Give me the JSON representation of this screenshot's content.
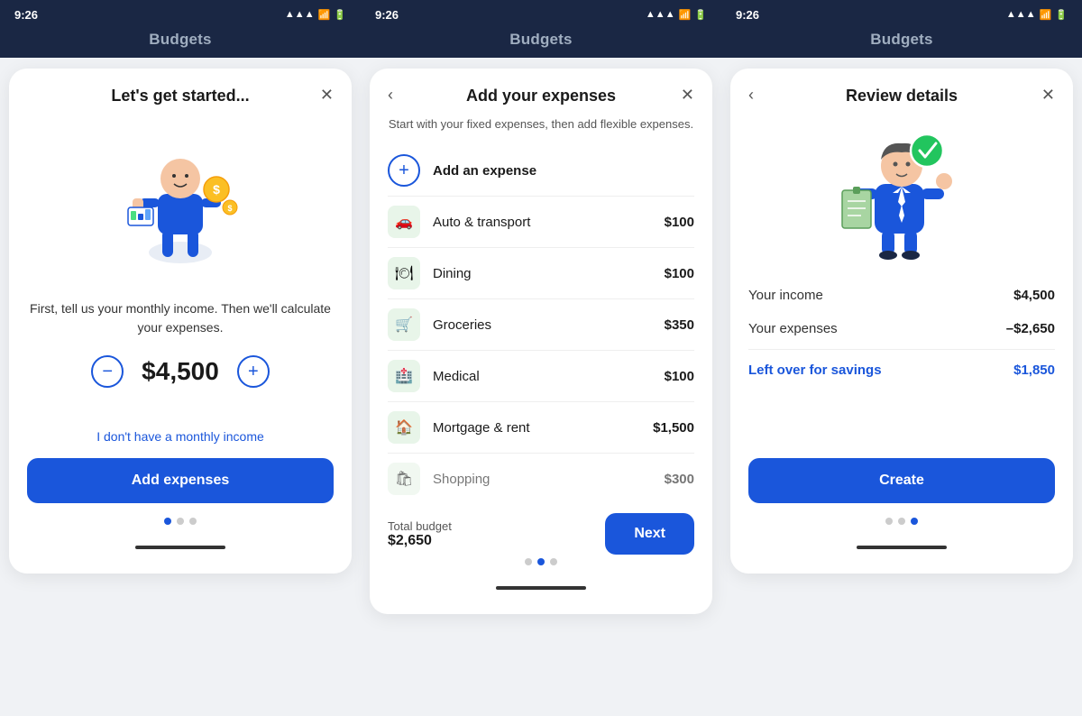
{
  "app_title": "Budgets",
  "status_bar": {
    "time": "9:26",
    "signal": "▲▲▲",
    "wifi": "WiFi",
    "battery": "Batt"
  },
  "panel1": {
    "title": "Let's get started...",
    "description": "First, tell us your monthly income.\nThen we'll calculate your expenses.",
    "income": "$4,500",
    "no_income_link": "I don't have a monthly income",
    "cta": "Add expenses",
    "dots": [
      true,
      false,
      false
    ]
  },
  "panel2": {
    "title": "Add your expenses",
    "subtitle": "Start with your fixed expenses,\nthen add flexible expenses.",
    "add_label": "Add an expense",
    "expenses": [
      {
        "name": "Auto & transport",
        "amount": "$100",
        "icon": "🚗"
      },
      {
        "name": "Dining",
        "amount": "$100",
        "icon": "🍽"
      },
      {
        "name": "Groceries",
        "amount": "$350",
        "icon": "🛒"
      },
      {
        "name": "Medical",
        "amount": "$100",
        "icon": "🏥"
      },
      {
        "name": "Mortgage & rent",
        "amount": "$1,500",
        "icon": "🏠"
      },
      {
        "name": "Shopping",
        "amount": "$300",
        "icon": "🛍"
      }
    ],
    "total_label": "Total budget",
    "total_value": "$2,650",
    "next_btn": "Next",
    "dots": [
      false,
      true,
      false
    ]
  },
  "panel3": {
    "title": "Review details",
    "income_label": "Your income",
    "income_value": "$4,500",
    "expenses_label": "Your expenses",
    "expenses_value": "–$2,650",
    "savings_label": "Left over for savings",
    "savings_value": "$1,850",
    "cta": "Create",
    "dots": [
      false,
      false,
      true
    ]
  }
}
